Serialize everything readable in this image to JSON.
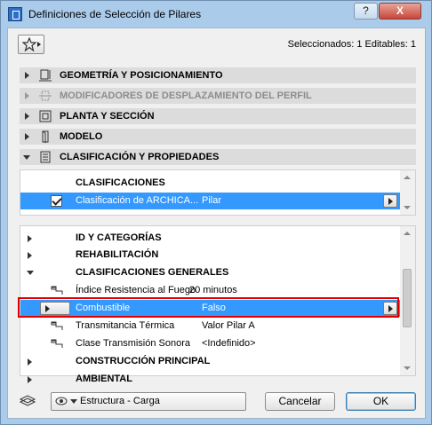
{
  "window": {
    "title": "Definiciones de Selección de Pilares",
    "help_label": "?",
    "close_label": "X"
  },
  "header": {
    "favorites_icon": "star-icon",
    "selection_info": "Seleccionados: 1 Editables: 1"
  },
  "sections": [
    {
      "label": "GEOMETRÍA Y POSICIONAMIENTO",
      "icon": "geometry-icon",
      "expanded": false,
      "enabled": true
    },
    {
      "label": "MODIFICADORES DE DESPLAZAMIENTO DEL PERFIL",
      "icon": "profile-offset-icon",
      "expanded": false,
      "enabled": false
    },
    {
      "label": "PLANTA Y SECCIÓN",
      "icon": "floor-plan-icon",
      "expanded": false,
      "enabled": true
    },
    {
      "label": "MODELO",
      "icon": "model-icon",
      "expanded": false,
      "enabled": true
    },
    {
      "label": "CLASIFICACIÓN Y PROPIEDADES",
      "icon": "classification-icon",
      "expanded": true,
      "enabled": true
    }
  ],
  "classifications": {
    "header": "CLASIFICACIONES",
    "row": {
      "name": "Clasificación de ARCHICA...",
      "value": "Pilar",
      "checked": true
    }
  },
  "properties": {
    "groups": [
      {
        "label": "ID Y CATEGORÍAS",
        "expanded": false
      },
      {
        "label": "REHABILITACIÓN",
        "expanded": false
      },
      {
        "label": "CLASIFICACIONES GENERALES",
        "expanded": true
      }
    ],
    "items": [
      {
        "name": "Índice Resistencia al Fuego",
        "value": "20 minutos"
      },
      {
        "name": "Combustible",
        "value": "Falso",
        "selected": true
      },
      {
        "name": "Transmitancia Térmica",
        "value": "Valor Pilar A"
      },
      {
        "name": "Clase Transmisión Sonora",
        "value": "<Indefinido>"
      }
    ],
    "groups_after": [
      {
        "label": "CONSTRUCCIÓN PRINCIPAL",
        "expanded": false
      },
      {
        "label": "AMBIENTAL",
        "expanded": false
      }
    ]
  },
  "footer": {
    "layer_combo": "Estructura - Carga",
    "cancel_label": "Cancelar",
    "ok_label": "OK"
  },
  "colors": {
    "selection": "#3399ff",
    "highlight_box": "#e00000",
    "title_bar": "#aacbea"
  }
}
